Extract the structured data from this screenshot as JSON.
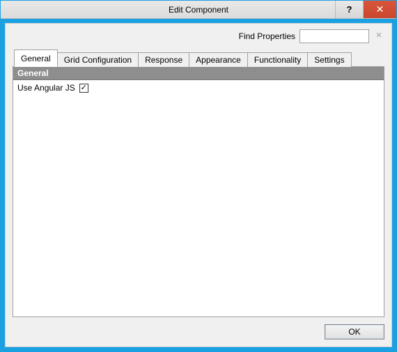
{
  "window": {
    "title": "Edit Component"
  },
  "find": {
    "label": "Find Properties",
    "value": "",
    "clear_glyph": "×"
  },
  "tabs": [
    {
      "label": "General",
      "active": true
    },
    {
      "label": "Grid Configuration",
      "active": false
    },
    {
      "label": "Response",
      "active": false
    },
    {
      "label": "Appearance",
      "active": false
    },
    {
      "label": "Functionality",
      "active": false
    },
    {
      "label": "Settings",
      "active": false
    }
  ],
  "general": {
    "section_title": "General",
    "use_angular_label": "Use Angular JS",
    "use_angular_checked": true
  },
  "buttons": {
    "ok": "OK"
  },
  "titlebar": {
    "help_glyph": "?",
    "close_glyph": "✕"
  }
}
